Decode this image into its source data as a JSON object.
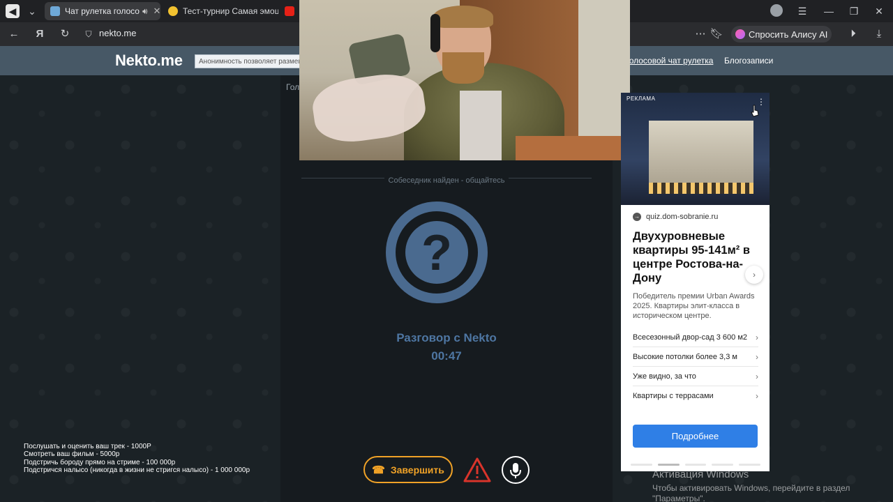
{
  "browser": {
    "tabs": [
      {
        "title": "Чат рулетка голосо"
      },
      {
        "title": "Тест-турнир Самая эмоц"
      },
      {
        "title": ""
      }
    ],
    "url": "nekto.me",
    "alice_label": "Спросить Алису AI"
  },
  "site": {
    "logo": "Nekto.me",
    "header_input": "Анонимность позволяет размеща",
    "nav": [
      "Голосовой чат рулетка",
      "Блогозаписи"
    ],
    "stage_tab": "Гол"
  },
  "chat": {
    "status": "Собеседник найден - общайтесь",
    "avatar_glyph": "?",
    "title": "Разговор с Nekto",
    "timer": "00:47",
    "end_button": "Завершить"
  },
  "ad": {
    "label": "РЕКЛАМА",
    "domain": "quiz.dom-sobranie.ru",
    "title": "Двухуровневые квартиры 95-141м² в центре Ростова-на-Дону",
    "description": "Победитель премии Urban Awards 2025. Квартиры элит-класса в историческом центре.",
    "items": [
      "Всесезонный двор-сад 3 600 м2",
      "Высокие потолки более 3,3 м",
      "Уже видно, за что",
      "Квартиры с террасами"
    ],
    "cta": "Подробнее"
  },
  "overlay_lines": [
    "Послушать и оценить ваш трек - 1000Р",
    "Смотреть ваш фильм - 5000р",
    "Подстричь бороду прямо на стриме - 100 000р",
    "Подстричся налысо (никогда в жизни не стригся налысо) - 1 000 000р"
  ],
  "windows_activation": {
    "title": "Активация Windows",
    "text": "Чтобы активировать Windows, перейдите в раздел \"Параметры\"."
  },
  "colors": {
    "accent_blue": "#4e76a2",
    "end_orange": "#f0a227",
    "warn_red": "#d9342b",
    "header_bg": "#475866",
    "cta_blue": "#2f7fe6"
  }
}
